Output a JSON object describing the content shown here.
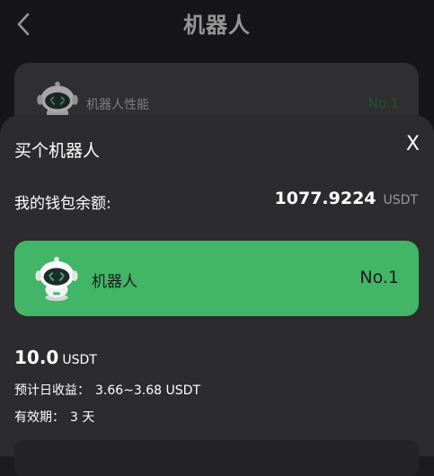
{
  "header": {
    "title": "机器人"
  },
  "background_card": {
    "label": "机器人性能",
    "number": "No.1"
  },
  "sheet": {
    "title": "买个机器人",
    "close_label": "X",
    "wallet": {
      "label": "我的钱包余额:",
      "value": "1077.9224",
      "unit": "USDT"
    },
    "robot": {
      "name": "机器人",
      "number": "No.1"
    },
    "price": {
      "value": "10.0",
      "unit": "USDT"
    },
    "daily_income": {
      "label": "预计日收益：",
      "value": "3.66~3.68 USDT"
    },
    "validity": {
      "label": "有效期：",
      "value": "3 天"
    }
  },
  "colors": {
    "accent": "#42b566",
    "sheet_bg": "#2c2c2e",
    "page_bg": "#1c1c1e"
  }
}
